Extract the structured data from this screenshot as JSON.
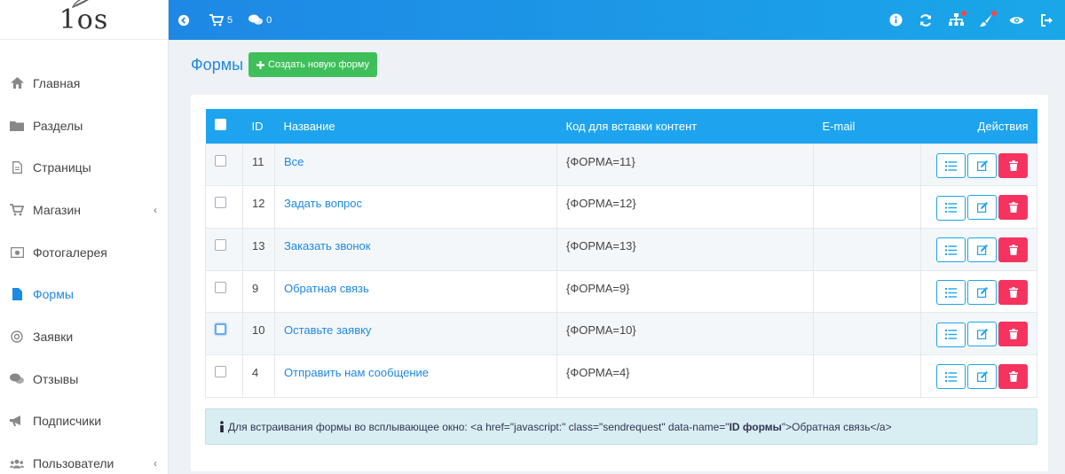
{
  "logo": {
    "text": "1os"
  },
  "sidebar": {
    "items": [
      {
        "label": "Главная",
        "icon": "home-icon"
      },
      {
        "label": "Разделы",
        "icon": "folder-icon"
      },
      {
        "label": "Страницы",
        "icon": "file-icon"
      },
      {
        "label": "Магазин",
        "icon": "cart-icon",
        "chevron": "‹"
      },
      {
        "label": "Фотогалерея",
        "icon": "image-icon"
      },
      {
        "label": "Формы",
        "icon": "form-icon",
        "active": true
      },
      {
        "label": "Заявки",
        "icon": "target-icon"
      },
      {
        "label": "Отзывы",
        "icon": "comments-icon"
      },
      {
        "label": "Подписчики",
        "icon": "bullhorn-icon"
      },
      {
        "label": "Пользователи",
        "icon": "users-icon",
        "chevron": "‹"
      }
    ]
  },
  "topbar": {
    "cart_count": "5",
    "comments_count": "0"
  },
  "page": {
    "title": "Формы",
    "create_button": "Создать новую форму"
  },
  "table": {
    "headers": {
      "id": "ID",
      "name": "Название",
      "code": "Код для вставки контент",
      "email": "E-mail",
      "actions": "Действия"
    },
    "rows": [
      {
        "id": "11",
        "name": "Все",
        "code": "{ФОРМА=11}",
        "email": ""
      },
      {
        "id": "12",
        "name": "Задать вопрос",
        "code": "{ФОРМА=12}",
        "email": ""
      },
      {
        "id": "13",
        "name": "Заказать звонок",
        "code": "{ФОРМА=13}",
        "email": ""
      },
      {
        "id": "9",
        "name": "Обратная связь",
        "code": "{ФОРМА=9}",
        "email": ""
      },
      {
        "id": "10",
        "name": "Оставьте заявку",
        "code": "{ФОРМА=10}",
        "email": ""
      },
      {
        "id": "4",
        "name": "Отправить нам сообщение",
        "code": "{ФОРМА=4}",
        "email": ""
      }
    ]
  },
  "alert": {
    "prefix": "Для встраивания формы во всплывающее окно: <a href=\"javascript:\" class=\"sendrequest\" data-name=\"",
    "bold": "ID формы",
    "suffix": "\">Обратная связь</a>"
  },
  "colors": {
    "accent": "#1e88e5",
    "header": "#1ea4ef",
    "create": "#3fbf5a",
    "delete": "#f6335f",
    "alert_bg": "#d9eef2"
  }
}
